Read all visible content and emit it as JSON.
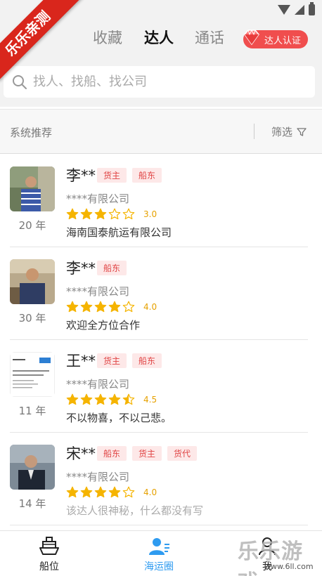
{
  "watermark": {
    "ribbon": "乐乐亲测",
    "corner_text": "乐乐游戏",
    "corner_url": "www.6ll.com"
  },
  "header": {
    "tabs": [
      {
        "label": "收藏",
        "active": false
      },
      {
        "label": "达人",
        "active": true
      },
      {
        "label": "通话",
        "active": false
      }
    ],
    "verify_button": "达人认证"
  },
  "search": {
    "placeholder": "找人、找船、找公司"
  },
  "filterbar": {
    "recommend": "系统推荐",
    "filter": "筛选"
  },
  "experts": [
    {
      "name": "李**",
      "tags": [
        "货主",
        "船东"
      ],
      "company": "****有限公司",
      "rating": 3.0,
      "score_label": "3.0",
      "years": "20 年",
      "desc": "海南国泰航运有限公司",
      "desc_placeholder": false
    },
    {
      "name": "李**",
      "tags": [
        "船东"
      ],
      "company": "****有限公司",
      "rating": 4.0,
      "score_label": "4.0",
      "years": "30 年",
      "desc": "欢迎全方位合作",
      "desc_placeholder": false
    },
    {
      "name": "王**",
      "tags": [
        "货主",
        "船东"
      ],
      "company": "****有限公司",
      "rating": 4.5,
      "score_label": "4.5",
      "years": "11 年",
      "desc": "不以物喜，不以己悲。",
      "desc_placeholder": false
    },
    {
      "name": "宋**",
      "tags": [
        "船东",
        "货主",
        "货代"
      ],
      "company": "****有限公司",
      "rating": 4.0,
      "score_label": "4.0",
      "years": "14 年",
      "desc": "该达人很神秘，什么都没有写",
      "desc_placeholder": true
    }
  ],
  "bottomnav": [
    {
      "label": "船位",
      "icon": "ship-icon",
      "active": false
    },
    {
      "label": "海运圈",
      "icon": "people-icon",
      "active": true
    },
    {
      "label": "我",
      "icon": "user-icon",
      "active": false
    }
  ],
  "colors": {
    "accent": "#2e9bf0",
    "tag_text": "#e04444",
    "tag_bg": "#fde8e8",
    "star": "#f5b400",
    "verify": "#f04e4e"
  }
}
